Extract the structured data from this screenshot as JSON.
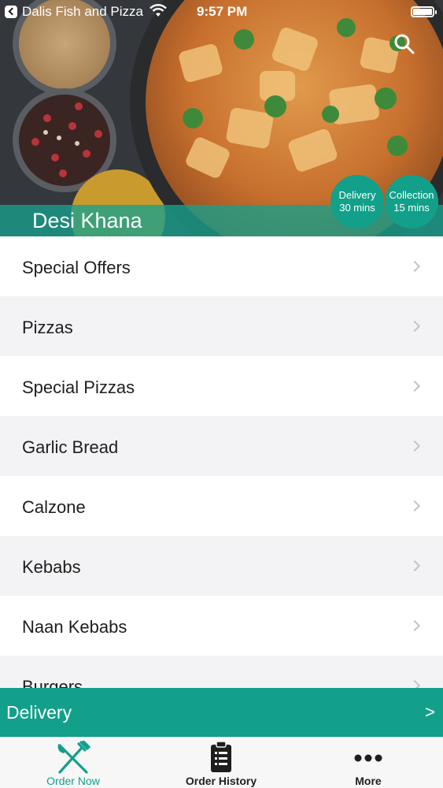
{
  "status_bar": {
    "back_app": "Dalis Fish and Pizza",
    "time": "9:57 PM"
  },
  "hero": {
    "title": "Desi Khana",
    "delivery": {
      "label": "Delivery",
      "time": "30 mins"
    },
    "collection": {
      "label": "Collection",
      "time": "15 mins"
    },
    "search_icon": "search-icon"
  },
  "menu": {
    "items": [
      {
        "label": "Special Offers"
      },
      {
        "label": "Pizzas"
      },
      {
        "label": "Special Pizzas"
      },
      {
        "label": "Garlic Bread"
      },
      {
        "label": "Calzone"
      },
      {
        "label": "Kebabs"
      },
      {
        "label": "Naan Kebabs"
      },
      {
        "label": "Burgers"
      }
    ]
  },
  "delivery_bar": {
    "label": "Delivery",
    "arrow": ">"
  },
  "tabbar": {
    "tabs": [
      {
        "label": "Order Now",
        "icon": "fork-knife-icon",
        "active": true
      },
      {
        "label": "Order History",
        "icon": "clipboard-icon",
        "active": false
      },
      {
        "label": "More",
        "icon": "more-dots-icon",
        "active": false
      }
    ]
  },
  "colors": {
    "accent": "#12a08a",
    "row_alt": "#f3f3f5",
    "text": "#1e1e1e"
  }
}
